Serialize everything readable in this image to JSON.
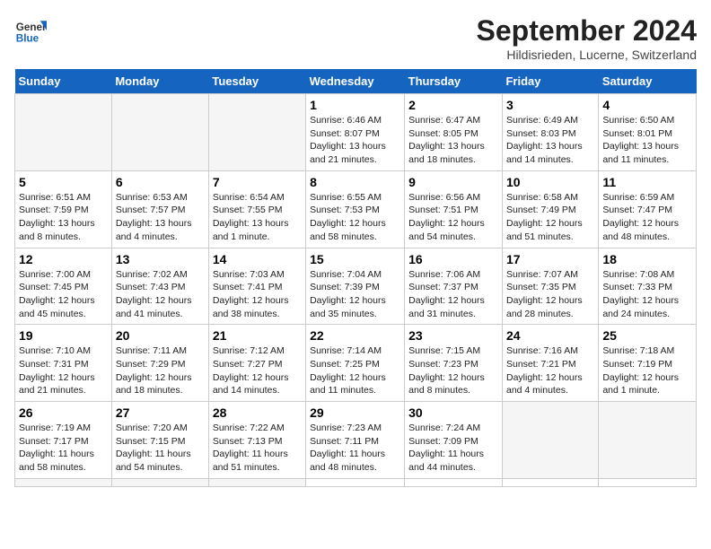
{
  "header": {
    "logo_line1": "General",
    "logo_line2": "Blue",
    "title": "September 2024",
    "subtitle": "Hildisrieden, Lucerne, Switzerland"
  },
  "weekdays": [
    "Sunday",
    "Monday",
    "Tuesday",
    "Wednesday",
    "Thursday",
    "Friday",
    "Saturday"
  ],
  "days": [
    {
      "num": "",
      "info": ""
    },
    {
      "num": "",
      "info": ""
    },
    {
      "num": "",
      "info": ""
    },
    {
      "num": "1",
      "info": "Sunrise: 6:46 AM\nSunset: 8:07 PM\nDaylight: 13 hours\nand 21 minutes."
    },
    {
      "num": "2",
      "info": "Sunrise: 6:47 AM\nSunset: 8:05 PM\nDaylight: 13 hours\nand 18 minutes."
    },
    {
      "num": "3",
      "info": "Sunrise: 6:49 AM\nSunset: 8:03 PM\nDaylight: 13 hours\nand 14 minutes."
    },
    {
      "num": "4",
      "info": "Sunrise: 6:50 AM\nSunset: 8:01 PM\nDaylight: 13 hours\nand 11 minutes."
    },
    {
      "num": "5",
      "info": "Sunrise: 6:51 AM\nSunset: 7:59 PM\nDaylight: 13 hours\nand 8 minutes."
    },
    {
      "num": "6",
      "info": "Sunrise: 6:53 AM\nSunset: 7:57 PM\nDaylight: 13 hours\nand 4 minutes."
    },
    {
      "num": "7",
      "info": "Sunrise: 6:54 AM\nSunset: 7:55 PM\nDaylight: 13 hours\nand 1 minute."
    },
    {
      "num": "8",
      "info": "Sunrise: 6:55 AM\nSunset: 7:53 PM\nDaylight: 12 hours\nand 58 minutes."
    },
    {
      "num": "9",
      "info": "Sunrise: 6:56 AM\nSunset: 7:51 PM\nDaylight: 12 hours\nand 54 minutes."
    },
    {
      "num": "10",
      "info": "Sunrise: 6:58 AM\nSunset: 7:49 PM\nDaylight: 12 hours\nand 51 minutes."
    },
    {
      "num": "11",
      "info": "Sunrise: 6:59 AM\nSunset: 7:47 PM\nDaylight: 12 hours\nand 48 minutes."
    },
    {
      "num": "12",
      "info": "Sunrise: 7:00 AM\nSunset: 7:45 PM\nDaylight: 12 hours\nand 45 minutes."
    },
    {
      "num": "13",
      "info": "Sunrise: 7:02 AM\nSunset: 7:43 PM\nDaylight: 12 hours\nand 41 minutes."
    },
    {
      "num": "14",
      "info": "Sunrise: 7:03 AM\nSunset: 7:41 PM\nDaylight: 12 hours\nand 38 minutes."
    },
    {
      "num": "15",
      "info": "Sunrise: 7:04 AM\nSunset: 7:39 PM\nDaylight: 12 hours\nand 35 minutes."
    },
    {
      "num": "16",
      "info": "Sunrise: 7:06 AM\nSunset: 7:37 PM\nDaylight: 12 hours\nand 31 minutes."
    },
    {
      "num": "17",
      "info": "Sunrise: 7:07 AM\nSunset: 7:35 PM\nDaylight: 12 hours\nand 28 minutes."
    },
    {
      "num": "18",
      "info": "Sunrise: 7:08 AM\nSunset: 7:33 PM\nDaylight: 12 hours\nand 24 minutes."
    },
    {
      "num": "19",
      "info": "Sunrise: 7:10 AM\nSunset: 7:31 PM\nDaylight: 12 hours\nand 21 minutes."
    },
    {
      "num": "20",
      "info": "Sunrise: 7:11 AM\nSunset: 7:29 PM\nDaylight: 12 hours\nand 18 minutes."
    },
    {
      "num": "21",
      "info": "Sunrise: 7:12 AM\nSunset: 7:27 PM\nDaylight: 12 hours\nand 14 minutes."
    },
    {
      "num": "22",
      "info": "Sunrise: 7:14 AM\nSunset: 7:25 PM\nDaylight: 12 hours\nand 11 minutes."
    },
    {
      "num": "23",
      "info": "Sunrise: 7:15 AM\nSunset: 7:23 PM\nDaylight: 12 hours\nand 8 minutes."
    },
    {
      "num": "24",
      "info": "Sunrise: 7:16 AM\nSunset: 7:21 PM\nDaylight: 12 hours\nand 4 minutes."
    },
    {
      "num": "25",
      "info": "Sunrise: 7:18 AM\nSunset: 7:19 PM\nDaylight: 12 hours\nand 1 minute."
    },
    {
      "num": "26",
      "info": "Sunrise: 7:19 AM\nSunset: 7:17 PM\nDaylight: 11 hours\nand 58 minutes."
    },
    {
      "num": "27",
      "info": "Sunrise: 7:20 AM\nSunset: 7:15 PM\nDaylight: 11 hours\nand 54 minutes."
    },
    {
      "num": "28",
      "info": "Sunrise: 7:22 AM\nSunset: 7:13 PM\nDaylight: 11 hours\nand 51 minutes."
    },
    {
      "num": "29",
      "info": "Sunrise: 7:23 AM\nSunset: 7:11 PM\nDaylight: 11 hours\nand 48 minutes."
    },
    {
      "num": "30",
      "info": "Sunrise: 7:24 AM\nSunset: 7:09 PM\nDaylight: 11 hours\nand 44 minutes."
    },
    {
      "num": "",
      "info": ""
    },
    {
      "num": "",
      "info": ""
    },
    {
      "num": "",
      "info": ""
    },
    {
      "num": "",
      "info": ""
    },
    {
      "num": "",
      "info": ""
    }
  ]
}
